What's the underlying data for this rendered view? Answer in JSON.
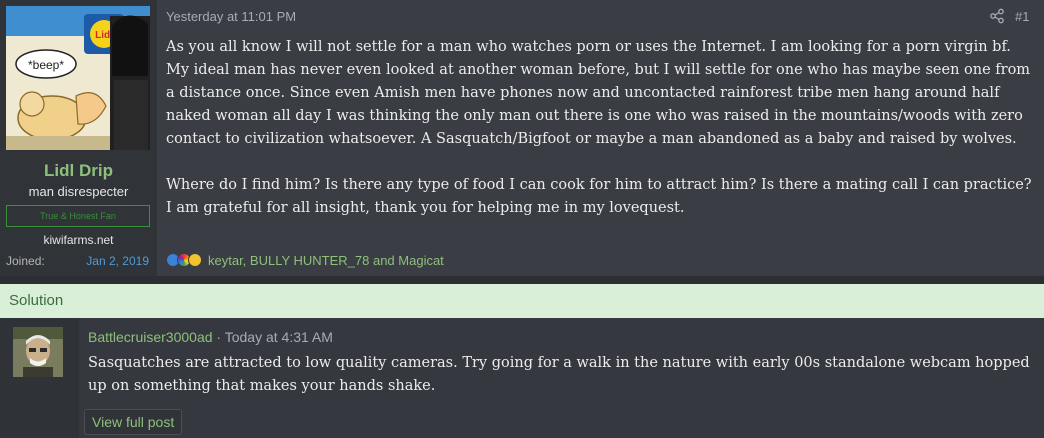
{
  "post": {
    "author": {
      "name": "Lidl Drip",
      "title": "man disrespecter",
      "banner": "True & Honest Fan",
      "site": "kiwifarms.net",
      "joined_label": "Joined:",
      "joined_date": "Jan 2, 2019",
      "avatar_caption": "*beep*",
      "avatar_logo": "Lidl"
    },
    "timestamp": "Yesterday at 11:01 PM",
    "share_icon": "share-icon",
    "number": "#1",
    "paragraphs": [
      "As you all know I will not settle for a man who watches porn or uses the Internet. I am looking for a porn virgin bf. My ideal man has never even looked at another woman before, but I will settle for one who has maybe seen one from a distance once. Since even Amish men have phones now and uncontacted rainforest tribe men hang around half naked woman all day I was thinking the only man out there is one who was raised in the mountains/woods with zero contact to civilization whatsoever. A Sasquatch/Bigfoot or maybe a man abandoned as a baby and raised by wolves.",
      "Where do I find him? Is there any type of food I can cook for him to attract him? Is there a mating call I can practice? I am grateful for all insight, thank you for helping me in my lovequest."
    ],
    "reactions": {
      "icons": [
        "like-reaction-icon",
        "rainbow-reaction-icon",
        "thinking-reaction-icon"
      ],
      "users_text": "keytar, BULLY HUNTER_78 and Magicat"
    }
  },
  "solution": {
    "label": "Solution",
    "author": "Battlecruiser3000ad",
    "separator": "·",
    "timestamp": "Today at 4:31 AM",
    "text": "Sasquatches are attracted to low quality cameras. Try going for a walk in the nature with early 00s standalone webcam hopped up on something that makes your hands shake.",
    "view_button": "View full post"
  },
  "colors": {
    "username_green": "#8ec07c",
    "link_blue": "#4f9bd6",
    "solution_bar": "#d9efd8",
    "post_bg": "#3a3d43"
  }
}
